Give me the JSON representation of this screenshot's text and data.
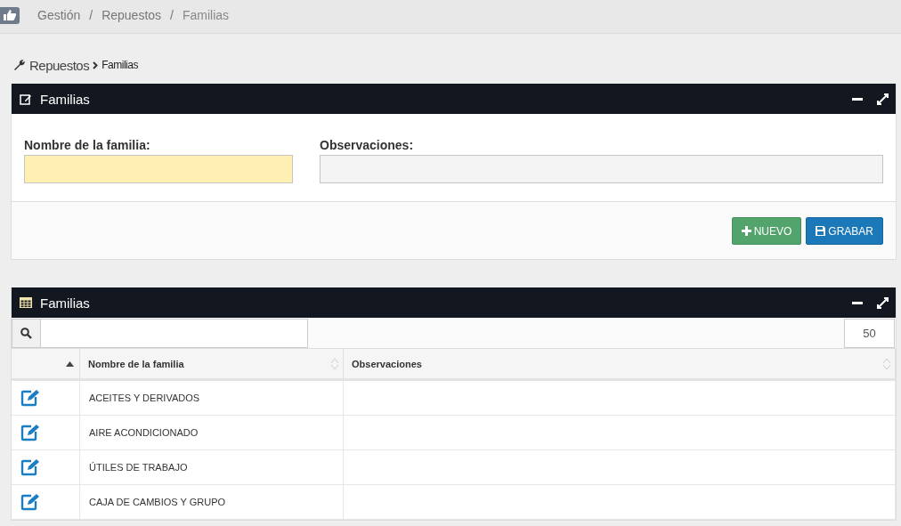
{
  "breadcrumb": [
    {
      "label": "Gestión"
    },
    {
      "separator": "/",
      "label": "Repuestos"
    },
    {
      "separator": "/",
      "label": "Familias"
    }
  ],
  "page_path": {
    "section": "Repuestos",
    "current": "Familias"
  },
  "form_panel": {
    "title": "Familias",
    "fields": [
      {
        "label": "Nombre de la familia:",
        "required": true
      },
      {
        "label": "Observaciones:",
        "required": false
      }
    ],
    "buttons": [
      {
        "kind": "new",
        "label": "NUEVO"
      },
      {
        "kind": "save",
        "label": "GRABAR"
      }
    ]
  },
  "table_panel": {
    "title": "Familias",
    "page_size": "50",
    "columns": [
      {},
      {
        "label": "Nombre de la familia"
      },
      {
        "label": "Observaciones"
      }
    ],
    "rows": [
      {
        "name": "ACEITES Y DERIVADOS"
      },
      {
        "name": "AIRE ACONDICIONADO"
      },
      {
        "name": "ÚTILES DE TRABAJO"
      },
      {
        "name": "CAJA DE CAMBIOS Y GRUPO"
      }
    ]
  }
}
